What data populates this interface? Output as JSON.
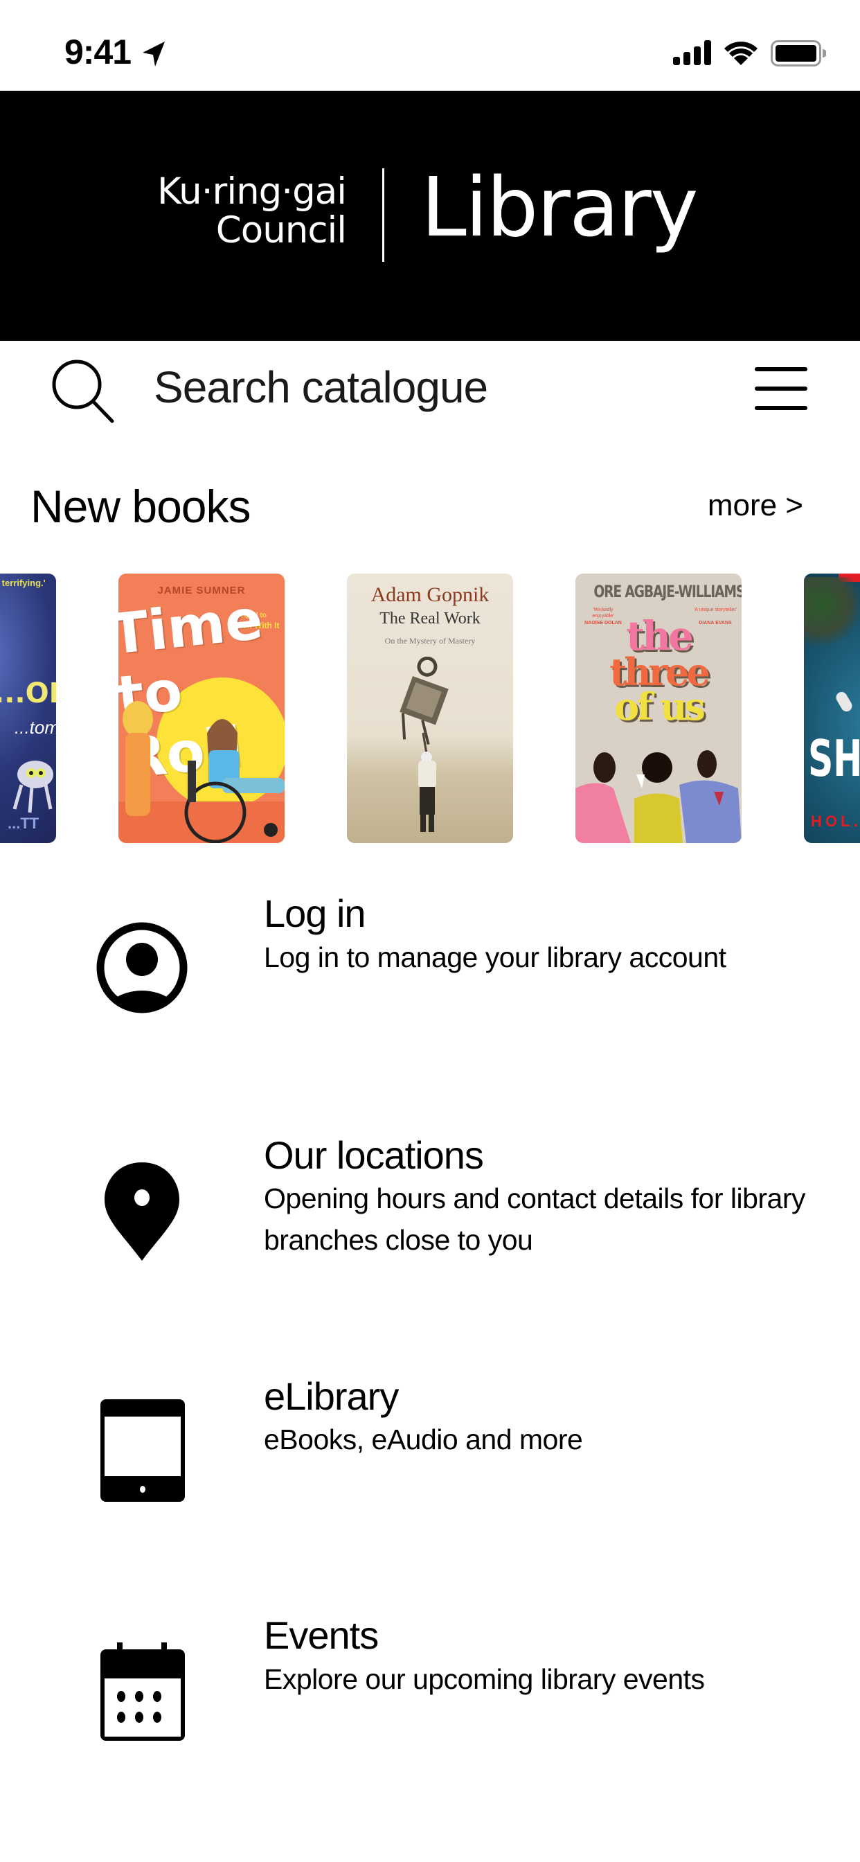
{
  "status_bar": {
    "time": "9:41",
    "icons": [
      "location-arrow-icon",
      "signal-icon",
      "wifi-icon",
      "battery-icon"
    ]
  },
  "header": {
    "council_line1": "Ku·ring·gai",
    "council_line2": "Council",
    "library_label": "Library"
  },
  "search": {
    "placeholder": "Search catalogue",
    "value": ""
  },
  "new_books": {
    "title": "New books",
    "more_label": "more >",
    "books": [
      {
        "title_fragment": "...OR ...ERS",
        "subtitle_fragment": "...toms",
        "author_fragment": "...TT",
        "quote": "...y terrifying.'",
        "colors": {
          "bg": "#2b3a7a",
          "accent": "#e8e05a"
        }
      },
      {
        "title": "Time to Roll",
        "author": "JAMIE SUMNER",
        "note_line1": "sequel to",
        "note_line2": "Roll With It",
        "colors": {
          "bg": "#f27f58",
          "accent": "#fde23a"
        }
      },
      {
        "title": "The Real Work",
        "author": "Adam Gopnik",
        "subtitle": "On the Mystery of Mastery",
        "colors": {
          "bg": "#e6ddcd",
          "accent": "#8a3a1e"
        }
      },
      {
        "title_line1": "the",
        "title_line2": "three",
        "title_line3": "of us",
        "author": "ORE AGBAJE-WILLIAMS",
        "quote_left": "'Wickedly enjoyable'",
        "quote_left_by": "NAOISE DOLAN",
        "quote_right": "'A unique storyteller'",
        "quote_right_by": "DIANA EVANS",
        "colors": {
          "bg": "#d9d0c6",
          "accent": "#f06a3a"
        }
      },
      {
        "title_fragment": "SHA...",
        "author_fragment": "HOL...",
        "colors": {
          "bg": "#17506a",
          "accent": "#e31b23"
        }
      }
    ]
  },
  "menu": [
    {
      "id": "login",
      "icon": "user-circle-icon",
      "title": "Log in",
      "description": "Log in to manage your library account"
    },
    {
      "id": "locations",
      "icon": "map-pin-icon",
      "title": "Our locations",
      "description": "Opening hours and contact details for library branches close to you"
    },
    {
      "id": "elibrary",
      "icon": "tablet-icon",
      "title": "eLibrary",
      "description": "eBooks, eAudio and more"
    },
    {
      "id": "events",
      "icon": "calendar-icon",
      "title": "Events",
      "description": "Explore our upcoming library events"
    }
  ]
}
